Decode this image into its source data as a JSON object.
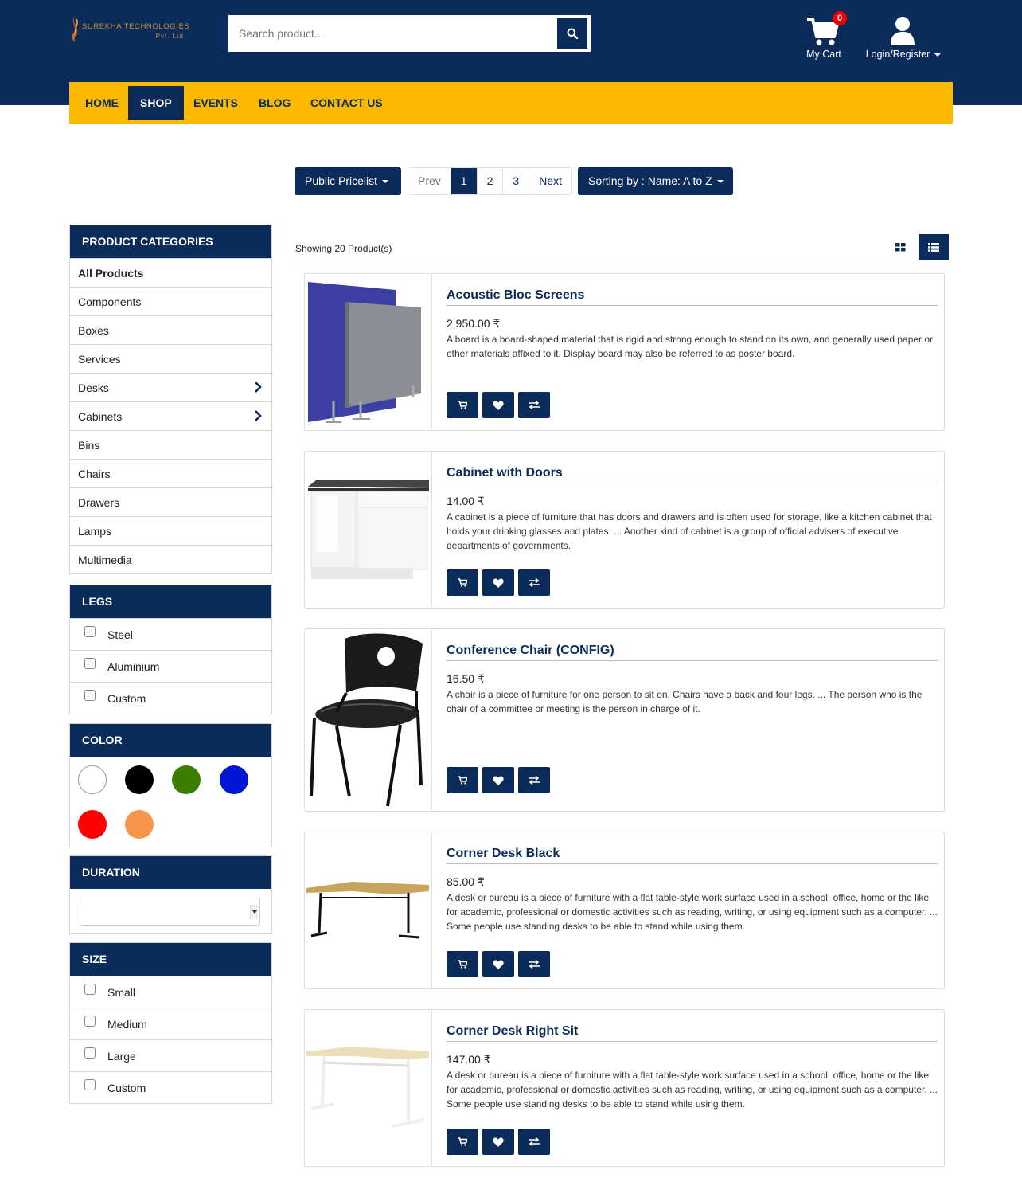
{
  "brand": {
    "line1": "SUREKHA TECHNOLOGIES",
    "line2": "Pvt. Ltd."
  },
  "search": {
    "placeholder": "Search product..."
  },
  "header": {
    "cart_count": "0",
    "cart_label": "My Cart",
    "login_label": "Login/Register"
  },
  "nav": {
    "items": [
      "HOME",
      "SHOP",
      "EVENTS",
      "BLOG",
      "CONTACT US"
    ],
    "active": "SHOP"
  },
  "toolbar": {
    "pricelist": "Public Pricelist",
    "pager": [
      "Prev",
      "1",
      "2",
      "3",
      "Next"
    ],
    "current_page": "1",
    "sorting": "Sorting by : Name: A to Z"
  },
  "categories": {
    "title": "PRODUCT CATEGORIES",
    "items": [
      "All Products",
      "Components",
      "Boxes",
      "Services",
      "Desks",
      "Cabinets",
      "Bins",
      "Chairs",
      "Drawers",
      "Lamps",
      "Multimedia"
    ],
    "expandable": [
      "Desks",
      "Cabinets"
    ]
  },
  "legs": {
    "title": "LEGS",
    "options": [
      "Steel",
      "Aluminium",
      "Custom"
    ]
  },
  "color": {
    "title": "COLOR",
    "swatches": [
      "#ffffff",
      "#000000",
      "#3a7d00",
      "#0018d6",
      "#ff0000",
      "#f7954a"
    ]
  },
  "duration": {
    "title": "DURATION",
    "value": ""
  },
  "size": {
    "title": "SIZE",
    "options": [
      "Small",
      "Medium",
      "Large",
      "Custom"
    ]
  },
  "results": {
    "showing": "Showing 20 Product(s)"
  },
  "products": [
    {
      "name": "Acoustic Bloc Screens",
      "price": "2,950.00 ₹",
      "desc": "A board is a board-shaped material that is rigid and strong enough to stand on its own, and generally used paper or other materials affixed to it. Display board may also be referred to as poster board."
    },
    {
      "name": "Cabinet with Doors",
      "price": "14.00 ₹",
      "desc": "A cabinet is a piece of furniture that has doors and drawers and is often used for storage, like a kitchen cabinet that holds your drinking glasses and plates. ... Another kind of cabinet is a group of official advisers of executive departments of governments."
    },
    {
      "name": "Conference Chair (CONFIG)",
      "price": "16.50 ₹",
      "desc": "A chair is a piece of furniture for one person to sit on. Chairs have a back and four legs. ... The person who is the chair of a committee or meeting is the person in charge of it."
    },
    {
      "name": "Corner Desk Black",
      "price": "85.00 ₹",
      "desc": "A desk or bureau is a piece of furniture with a flat table-style work surface used in a school, office, home or the like for academic, professional or domestic activities such as reading, writing, or using equipment such as a computer. ... Some people use standing desks to be able to stand while using them."
    },
    {
      "name": "Corner Desk Right Sit",
      "price": "147.00 ₹",
      "desc": "A desk or bureau is a piece of furniture with a flat table-style work surface used in a school, office, home or the like for academic, professional or domestic activities such as reading, writing, or using equipment such as a computer. ... Some people use standing desks to be able to stand while using them."
    }
  ],
  "colors": {
    "primary": "#0b2b5a",
    "accent": "#fbb900",
    "badge": "#ee0000"
  }
}
